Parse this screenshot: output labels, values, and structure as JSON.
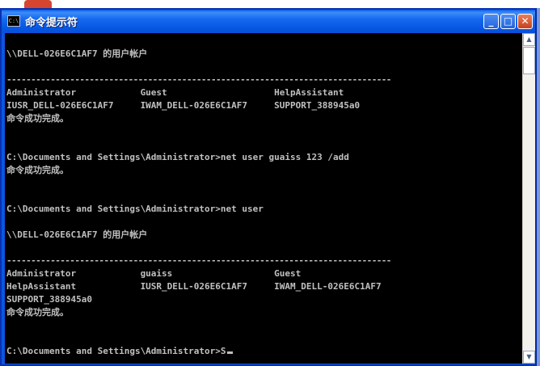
{
  "window": {
    "title": "命令提示符",
    "app_icon": "C:\\",
    "buttons": {
      "minimize": "_",
      "maximize": "□",
      "close": "✕"
    }
  },
  "console": {
    "lines": [
      {
        "text": "\\\\DELL-026E6C1AF7 的用户帐户"
      },
      {
        "text": "-------------------------------------------------------------------------------"
      },
      {
        "text": "Administrator            Guest                    HelpAssistant"
      },
      {
        "text": "IUSR_DELL-026E6C1AF7     IWAM_DELL-026E6C1AF7     SUPPORT_388945a0"
      },
      {
        "text": "命令成功完成。"
      },
      {
        "text": "C:\\Documents and Settings\\Administrator>net user guaiss 123 /add"
      },
      {
        "text": "命令成功完成。"
      },
      {
        "text": "C:\\Documents and Settings\\Administrator>net user"
      },
      {
        "text": "\\\\DELL-026E6C1AF7 的用户帐户"
      },
      {
        "text": "-------------------------------------------------------------------------------"
      },
      {
        "text": "Administrator            guaiss                   Guest"
      },
      {
        "text": "HelpAssistant            IUSR_DELL-026E6C1AF7     IWAM_DELL-026E6C1AF7"
      },
      {
        "text": "SUPPORT_388945a0"
      },
      {
        "text": "命令成功完成。"
      },
      {
        "text": "C:\\Documents and Settings\\Administrator>S"
      }
    ]
  },
  "scrollbar": {
    "up_icon": "▲",
    "down_icon": "▼"
  },
  "colors": {
    "console_bg": "#000000",
    "console_text": "#c0c0c0",
    "titlebar": "#0a5ce8"
  }
}
